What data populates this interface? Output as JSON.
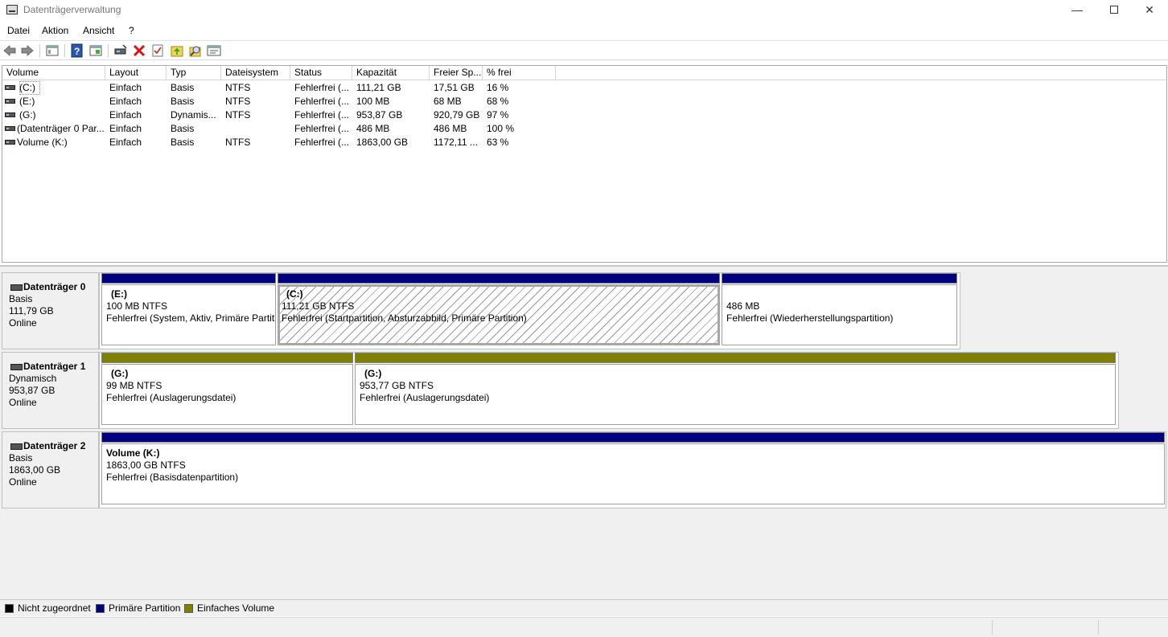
{
  "window": {
    "title": "Datenträgerverwaltung",
    "minimize": "—",
    "close": "✕"
  },
  "menu": [
    "Datei",
    "Aktion",
    "Ansicht",
    "?"
  ],
  "toolbar": [
    "back-icon",
    "forward-icon",
    "console-tree-icon",
    "help-icon",
    "properties-pane-icon",
    "connect-disk-icon",
    "delete-icon",
    "check-icon",
    "format-icon",
    "explore-icon",
    "settings-pane-icon"
  ],
  "list": {
    "columns": [
      "Volume",
      "Layout",
      "Typ",
      "Dateisystem",
      "Status",
      "Kapazität",
      "Freier Sp...",
      "% frei"
    ],
    "rows": [
      [
        "(C:)",
        "Einfach",
        "Basis",
        "NTFS",
        "Fehlerfrei (...",
        "111,21 GB",
        "17,51 GB",
        "16 %"
      ],
      [
        "(E:)",
        "Einfach",
        "Basis",
        "NTFS",
        "Fehlerfrei (...",
        "100 MB",
        "68 MB",
        "68 %"
      ],
      [
        "(G:)",
        "Einfach",
        "Dynamis...",
        "NTFS",
        "Fehlerfrei (...",
        "953,87 GB",
        "920,79 GB",
        "97 %"
      ],
      [
        "(Datenträger 0 Par...",
        "Einfach",
        "Basis",
        "",
        "Fehlerfrei (...",
        "486 MB",
        "486 MB",
        "100 %"
      ],
      [
        "Volume (K:)",
        "Einfach",
        "Basis",
        "NTFS",
        "Fehlerfrei (...",
        "1863,00 GB",
        "1172,11 ...",
        "63 %"
      ]
    ]
  },
  "disks": [
    {
      "name": "Datenträger 0",
      "type": "Basis",
      "size": "111,79 GB",
      "state": "Online",
      "partitions": [
        {
          "name": "(E:)",
          "size": "100 MB NTFS",
          "status": "Fehlerfrei (System, Aktiv, Primäre Partition)",
          "kind": "primary"
        },
        {
          "name": "(C:)",
          "size": "111,21 GB NTFS",
          "status": "Fehlerfrei (Startpartition, Absturzabbild, Primäre Partition)",
          "kind": "primary",
          "selected": true
        },
        {
          "name": "",
          "size": "486 MB",
          "status": "Fehlerfrei (Wiederherstellungspartition)",
          "kind": "primary"
        }
      ]
    },
    {
      "name": "Datenträger 1",
      "type": "Dynamisch",
      "size": "953,87 GB",
      "state": "Online",
      "partitions": [
        {
          "name": "(G:)",
          "size": "99 MB NTFS",
          "status": "Fehlerfrei (Auslagerungsdatei)",
          "kind": "simple"
        },
        {
          "name": "(G:)",
          "size": "953,77 GB NTFS",
          "status": "Fehlerfrei (Auslagerungsdatei)",
          "kind": "simple"
        }
      ]
    },
    {
      "name": "Datenträger 2",
      "type": "Basis",
      "size": "1863,00 GB",
      "state": "Online",
      "partitions": [
        {
          "name": "Volume  (K:)",
          "size": "1863,00 GB NTFS",
          "status": "Fehlerfrei (Basisdatenpartition)",
          "kind": "primary"
        }
      ]
    }
  ],
  "legend": [
    {
      "label": "Nicht zugeordnet",
      "color": "#000000"
    },
    {
      "label": "Primäre Partition",
      "color": "#000080"
    },
    {
      "label": "Einfaches Volume",
      "color": "#808000"
    }
  ]
}
